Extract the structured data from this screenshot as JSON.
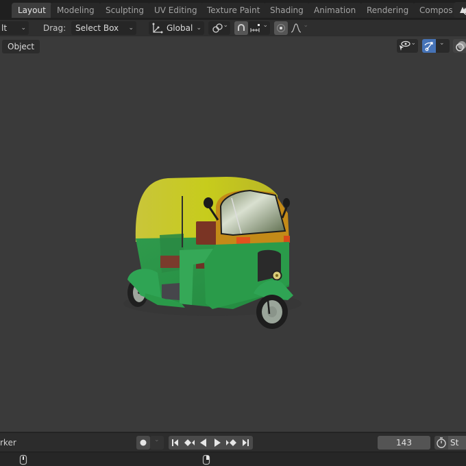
{
  "workspace_tabs": [
    {
      "label": "Layout",
      "active": true
    },
    {
      "label": "Modeling",
      "active": false
    },
    {
      "label": "Sculpting",
      "active": false
    },
    {
      "label": "UV Editing",
      "active": false
    },
    {
      "label": "Texture Paint",
      "active": false
    },
    {
      "label": "Shading",
      "active": false
    },
    {
      "label": "Animation",
      "active": false
    },
    {
      "label": "Rendering",
      "active": false
    },
    {
      "label": "Compos",
      "active": false
    }
  ],
  "tool_header": {
    "mode_dropdown": "lt",
    "drag_label": "Drag:",
    "drag_value": "Select Box",
    "transform_orientation": "Global",
    "icons": [
      "transform-orientation-icon",
      "pivot-link-icon",
      "snap-magnet-icon",
      "snap-increment-icon",
      "proportional-edit-icon",
      "falloff-curve-icon"
    ]
  },
  "viewport": {
    "object_menu": "Object",
    "header_icons": [
      "visibility-selectability-icon",
      "gizmo-toggle-icon",
      "overlay-icon"
    ],
    "model_description": "Green and yellow auto rickshaw 3D model",
    "model_colors": {
      "roof": "#c9cc1f",
      "body": "#2fa04f",
      "trim": "#c8921c",
      "seat": "#7a3424",
      "tire": "#1e1e1e",
      "rim": "#9aa39a"
    }
  },
  "timeline": {
    "marker_text": "rker",
    "current_frame": "143",
    "start_label": "St",
    "playback_icons": [
      "jump-start-icon",
      "prev-keyframe-icon",
      "play-reverse-icon",
      "play-icon",
      "next-keyframe-icon",
      "jump-end-icon"
    ]
  },
  "statusbar": {
    "icons": [
      "mouse-left-icon",
      "mouse-right-icon"
    ]
  },
  "colors": {
    "accent_blue": "#4673b7",
    "viewport_bg": "#3a3a3a",
    "header_bg": "#2e2e2e",
    "tabbar_bg": "#1f1f1f"
  }
}
